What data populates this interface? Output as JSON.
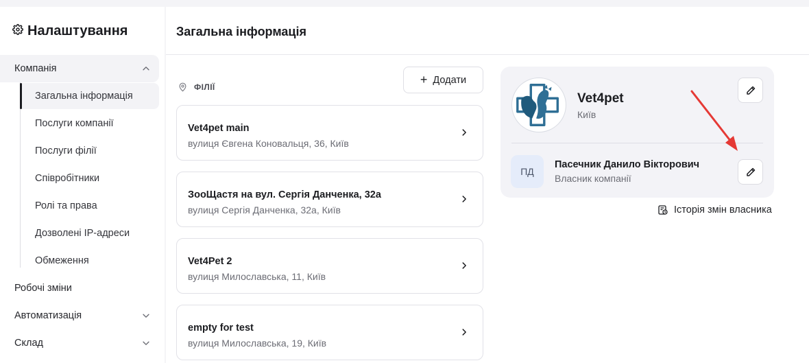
{
  "sidebar": {
    "title": "Налаштування",
    "sections": [
      {
        "label": "Компанія",
        "expanded": true
      },
      {
        "label": "Робочі зміни"
      },
      {
        "label": "Автоматизація",
        "expanded": false
      },
      {
        "label": "Склад",
        "expanded": false
      }
    ],
    "company_items": [
      {
        "label": "Загальна інформація",
        "active": true
      },
      {
        "label": "Послуги компанії"
      },
      {
        "label": "Послуги філії"
      },
      {
        "label": "Співробітники"
      },
      {
        "label": "Ролі та права"
      },
      {
        "label": "Дозволені IP-адреси"
      },
      {
        "label": "Обмеження"
      }
    ]
  },
  "main": {
    "title": "Загальна інформація",
    "branches_label": "ФІЛІЇ",
    "add_label": "Додати",
    "branches": [
      {
        "name": "Vet4pet main",
        "address": "вулиця Євгена Коновальця, 36, Київ"
      },
      {
        "name": "ЗооЩастя на вул. Сергія Данченка, 32а",
        "address": "вулиця Сергія Данченка, 32а, Київ"
      },
      {
        "name": "Vet4Pet 2",
        "address": "вулиця Милославська, 11, Київ"
      },
      {
        "name": "empty for test",
        "address": "вулиця Милославська, 19, Київ"
      }
    ]
  },
  "company": {
    "name": "Vet4pet",
    "city": "Київ",
    "owner": {
      "initials": "ПД",
      "name": "Пасечник Данило Вікторович",
      "role": "Власник компанії"
    },
    "history_label": "Історія змін власника"
  },
  "colors": {
    "accent_dark": "#1b1c20",
    "panel_bg": "#f3f3f7",
    "avatar_bg": "#e5ecfa",
    "logo_blue": "#2f6f95",
    "arrow_red": "#e53935"
  },
  "icons": [
    "gear-icon",
    "chevron-up-icon",
    "chevron-down-icon",
    "location-pin-icon",
    "plus-icon",
    "chevron-right-icon",
    "pencil-icon",
    "history-icon"
  ]
}
